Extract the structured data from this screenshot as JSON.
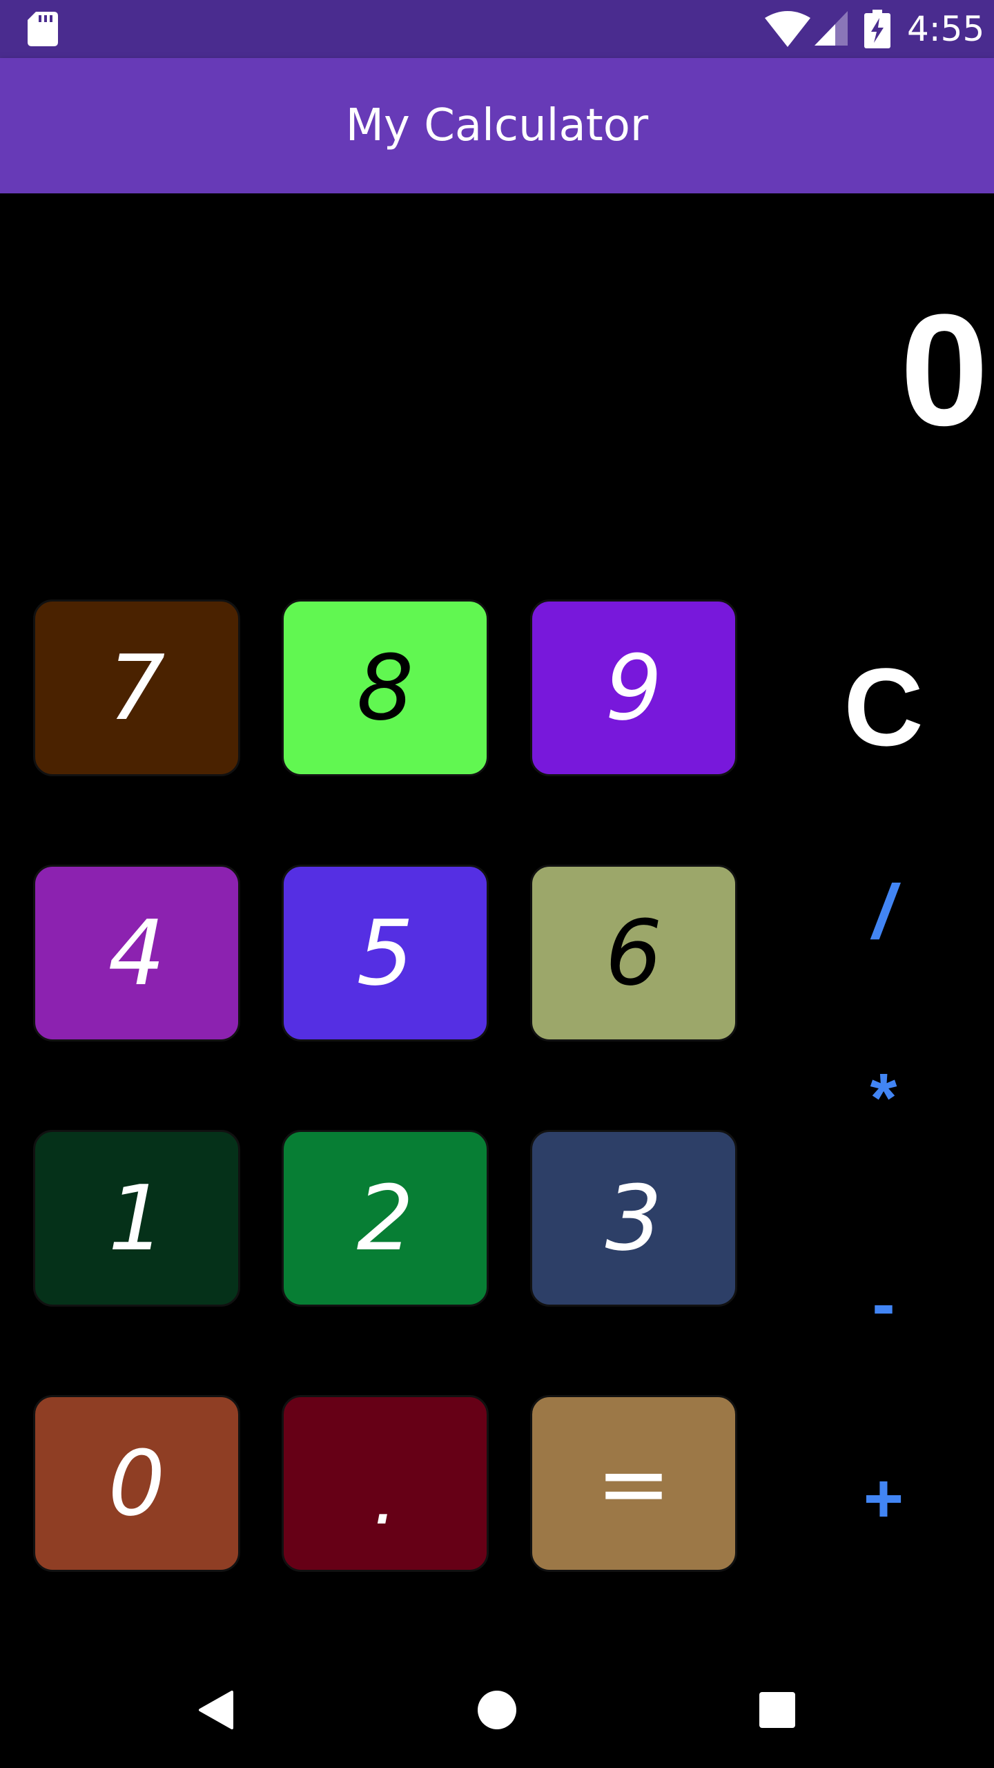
{
  "status_bar": {
    "time": "4:55",
    "icons": [
      "sd-card-icon",
      "wifi-icon",
      "signal-icon",
      "battery-charging-icon"
    ]
  },
  "app_bar": {
    "title": "My Calculator",
    "color": "#673ab7"
  },
  "display": {
    "value": "0"
  },
  "keypad": {
    "rows": [
      [
        {
          "label": "7",
          "color": "#4a2200"
        },
        {
          "label": "8",
          "color": "#61f751"
        },
        {
          "label": "9",
          "color": "#7818db"
        }
      ],
      [
        {
          "label": "4",
          "color": "#8c22b0"
        },
        {
          "label": "5",
          "color": "#552fe3"
        },
        {
          "label": "6",
          "color": "#9ca76a"
        }
      ],
      [
        {
          "label": "1",
          "color": "#053119"
        },
        {
          "label": "2",
          "color": "#077e34"
        },
        {
          "label": "3",
          "color": "#2d3f67"
        }
      ],
      [
        {
          "label": "0",
          "color": "#8f3e24"
        },
        {
          "label": ".",
          "color": "#660016"
        },
        {
          "label": "=",
          "color": "#9c7847"
        }
      ]
    ]
  },
  "operators": {
    "clear": "C",
    "divide": "/",
    "multiply": "*",
    "subtract": "-",
    "add": "+",
    "color": "#4285f4"
  },
  "nav_bar": {
    "icons": [
      "back-icon",
      "home-icon",
      "recents-icon"
    ]
  }
}
